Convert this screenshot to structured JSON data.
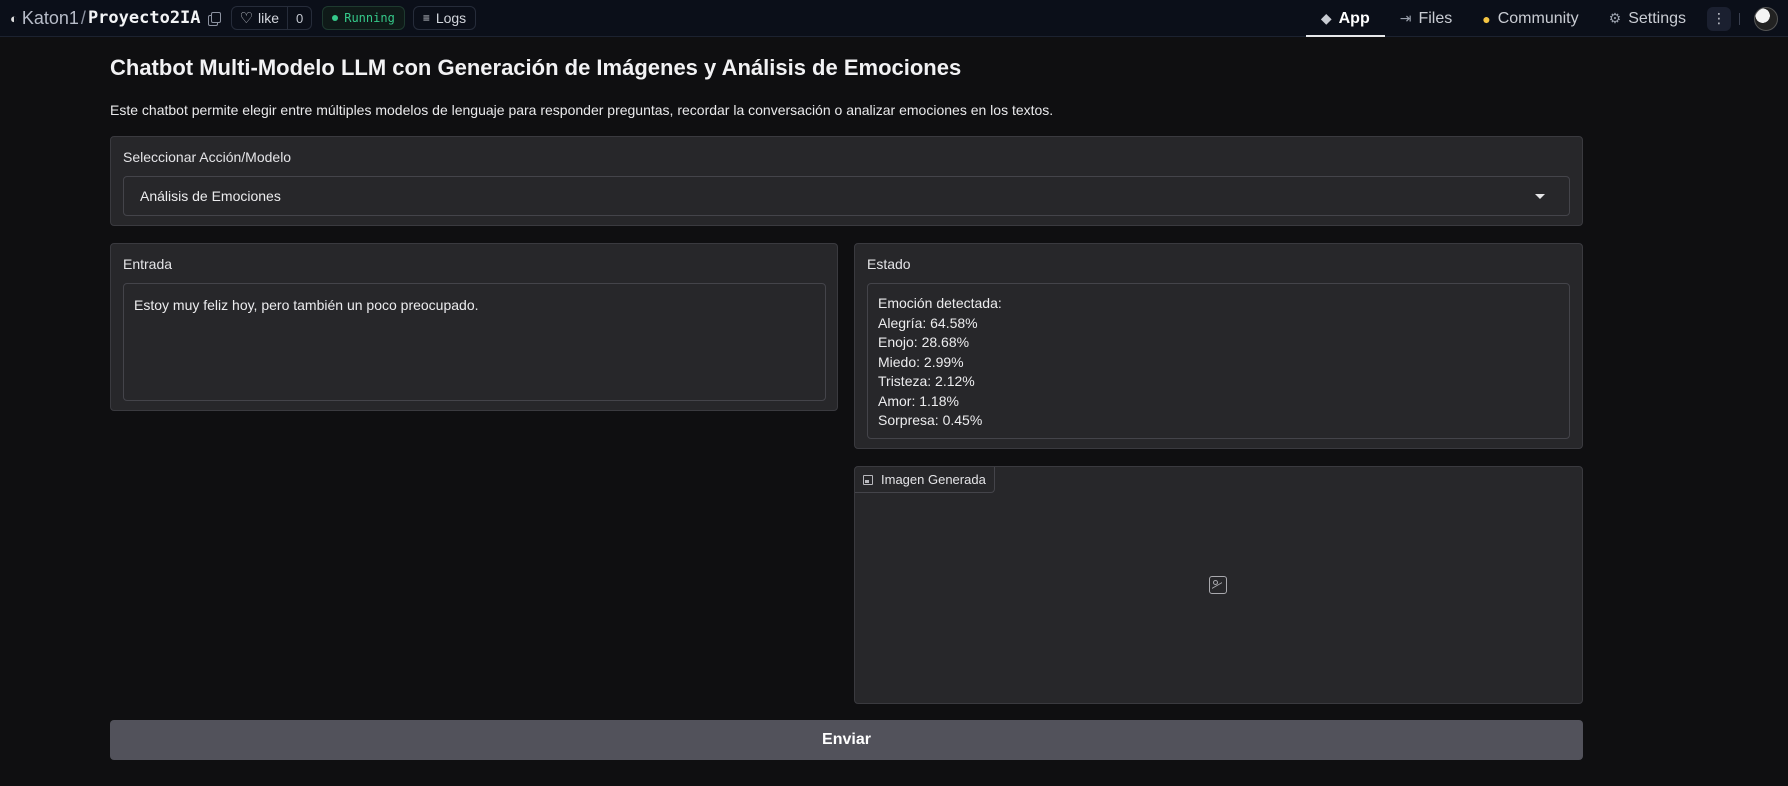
{
  "header": {
    "owner": "Katon1",
    "separator": "/",
    "repo_name": "Proyecto2IA",
    "like_label": "like",
    "like_count": "0",
    "status": "Running",
    "logs_label": "Logs",
    "nav": [
      {
        "label": "App",
        "icon": "cube-icon"
      },
      {
        "label": "Files",
        "icon": "files-icon"
      },
      {
        "label": "Community",
        "icon": "community-icon"
      },
      {
        "label": "Settings",
        "icon": "gear-icon"
      }
    ],
    "more_label": "⋮"
  },
  "page": {
    "title": "Chatbot Multi-Modelo LLM con Generación de Imágenes y Análisis de Emociones",
    "description": "Este chatbot permite elegir entre múltiples modelos de lenguaje para responder preguntas, recordar la conversación o analizar emociones en los textos."
  },
  "select": {
    "label": "Seleccionar Acción/Modelo",
    "value": "Análisis de Emociones"
  },
  "input": {
    "label": "Entrada",
    "value": "Estoy muy feliz hoy, pero también un poco preocupado."
  },
  "status": {
    "label": "Estado",
    "lines": [
      "Emoción detectada:",
      "Alegría: 64.58%",
      "Enojo: 28.68%",
      "Miedo: 2.99%",
      "Tristeza: 2.12%",
      "Amor: 1.18%",
      "Sorpresa: 0.45%"
    ]
  },
  "image": {
    "label": "Imagen Generada"
  },
  "submit": {
    "label": "Enviar"
  },
  "colors": {
    "background": "#0f0f11",
    "panel": "#27272a",
    "button": "#52525b",
    "running": "#35c98a"
  }
}
